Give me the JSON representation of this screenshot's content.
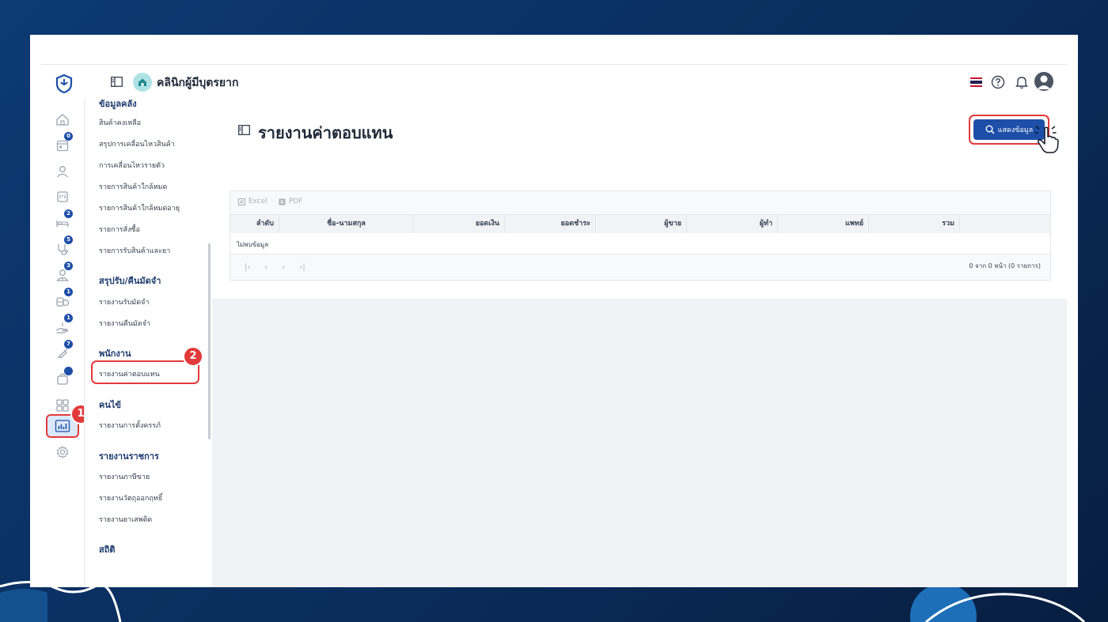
{
  "app": {
    "clinic_name": "คลินิกผู้มีบุตรยาก",
    "icons": {
      "brand": "shield-heart-icon",
      "clinic": "home-icon",
      "language": "thai-flag-icon",
      "help": "help-icon",
      "notifications": "bell-icon",
      "profile": "avatar"
    },
    "colors": {
      "primary": "#1e4fa8",
      "highlight": "#e23a3a",
      "background": "#0a2d5c"
    }
  },
  "rail": {
    "items": [
      {
        "icon": "home-icon",
        "badge": ""
      },
      {
        "icon": "calendar-icon",
        "badge": "0"
      },
      {
        "icon": "user-icon",
        "badge": ""
      },
      {
        "icon": "clipboard-icon",
        "badge": ""
      },
      {
        "icon": "bed-icon",
        "badge": "2"
      },
      {
        "icon": "stethoscope-icon",
        "badge": "5"
      },
      {
        "icon": "doctor-icon",
        "badge": "3"
      },
      {
        "icon": "pills-icon",
        "badge": "1"
      },
      {
        "icon": "hand-pay-icon",
        "badge": "1"
      },
      {
        "icon": "syringe-icon",
        "badge": "7"
      },
      {
        "icon": "cart-icon",
        "badge": ""
      },
      {
        "icon": "grid-icon",
        "badge": ""
      },
      {
        "icon": "chart-icon",
        "badge": ""
      },
      {
        "icon": "gear-icon",
        "badge": ""
      }
    ],
    "step_one": "1"
  },
  "submenu": {
    "cut_heading": "ข้อมูลคลัง",
    "stock": [
      "สินค้าคงเหลือ",
      "สรุปการเคลื่อนไหวสินค้า",
      "การเคลื่อนไหวรายตัว",
      "รายการสินค้าใกล้หมด",
      "รายการสินค้าใกล้หมดอายุ",
      "รายการสั่งซื้อ",
      "รายการรับสินค้าและยา"
    ],
    "deposit_heading": "สรุปรับ/คืนมัดจำ",
    "deposit": [
      "รายงานรับมัดจำ",
      "รายงานคืนมัดจำ"
    ],
    "staff_heading": "พนักงาน",
    "staff_item": "รายงานค่าตอบแทน",
    "step_two": "2",
    "patient_heading": "คนไข้",
    "patient_item": "รายงานการตั้งครรภ์",
    "gov_heading": "รายงานราชการ",
    "gov": [
      "รายงานภาษีขาย",
      "รายงานวัตถุออกฤทธิ์",
      "รายงานยาเสพติด"
    ],
    "stats_heading": "สถิติ"
  },
  "page": {
    "title": "รายงานค่าตอบแทน",
    "search_button": "แสดงข้อมูล"
  },
  "table": {
    "export_excel": "Excel",
    "export_pdf": "PDF",
    "columns": [
      "ลำดับ",
      "ชื่อ-นามสกุล",
      "ยอดเงิน",
      "ยอดชำระ",
      "ผู้ขาย",
      "ผู้ทำ",
      "แพทย์",
      "รวม"
    ],
    "empty_text": "ไม่พบข้อมูล",
    "page_info": "0 จาก 0 หน้า (0 รายการ)"
  }
}
